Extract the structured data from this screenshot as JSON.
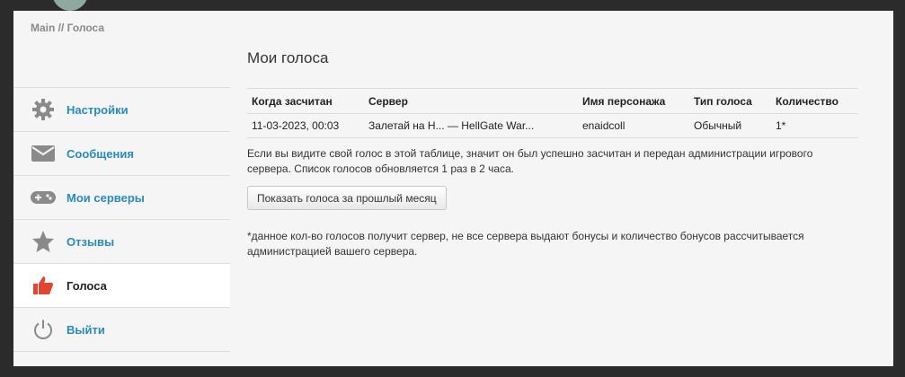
{
  "breadcrumb": "Main // Голоса",
  "sidebar": {
    "items": [
      {
        "label": "Настройки",
        "icon": "gear-icon",
        "active": false
      },
      {
        "label": "Сообщения",
        "icon": "envelope-icon",
        "active": false
      },
      {
        "label": "Мои серверы",
        "icon": "gamepad-icon",
        "active": false
      },
      {
        "label": "Отзывы",
        "icon": "star-icon",
        "active": false
      },
      {
        "label": "Голоса",
        "icon": "thumbs-up-icon",
        "active": true
      },
      {
        "label": "Выйти",
        "icon": "power-icon",
        "active": false
      }
    ]
  },
  "main": {
    "title": "Мои голоса",
    "table": {
      "headers": [
        "Когда засчитан",
        "Сервер",
        "Имя персонажа",
        "Тип голоса",
        "Количество"
      ],
      "rows": [
        [
          "11-03-2023, 00:03",
          "Залетай на Н... — HellGate War...",
          "enaidcoll",
          "Обычный",
          "1*"
        ]
      ]
    },
    "info_text": "Если вы видите свой голос в этой таблице, значит он был успешно засчитан и передан администрации игрового сервера. Список голосов обновляется 1 раз в 2 часа.",
    "button_label": "Показать голоса за прошлый месяц",
    "note_text": "*данное кол-во голосов получит сервер, не все сервера выдают бонусы и количество бонусов рассчитывается администрацией вашего сервера."
  },
  "colors": {
    "link": "#2a8ab8",
    "active_icon": "#e0452f",
    "icon_gray": "#8a8a8a"
  }
}
